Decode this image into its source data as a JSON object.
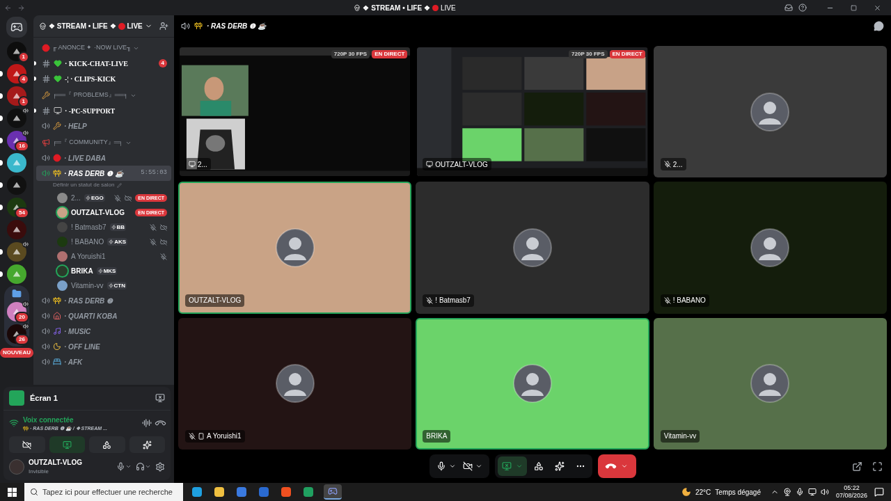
{
  "window": {
    "title": "❖ STREAM • LIFE ❖",
    "title_live": "LIVE"
  },
  "servers": [
    {
      "kind": "server",
      "color": "#0d0d0d",
      "badge": "1",
      "unread": false,
      "voice": false
    },
    {
      "kind": "server",
      "color": "#c01818",
      "badge": "4",
      "unread": true,
      "voice": false
    },
    {
      "kind": "server",
      "color": "#a51a1a",
      "badge": "1",
      "unread": true,
      "voice": false
    },
    {
      "kind": "server",
      "color": "#101010",
      "unread": true,
      "voice": true
    },
    {
      "kind": "server",
      "color": "#6a30b0",
      "badge": "16",
      "unread": true,
      "voice": true
    },
    {
      "kind": "server",
      "color": "#3ab8cc",
      "unread": true,
      "voice": false
    },
    {
      "kind": "server",
      "color": "#111111",
      "unread": true,
      "voice": false
    },
    {
      "kind": "server",
      "color": "#1c3a10",
      "badge": "54",
      "unread": true,
      "voice": false
    },
    {
      "kind": "server",
      "color": "#3a0c0c",
      "unread": false,
      "voice": false
    },
    {
      "kind": "server",
      "color": "#5a4a20",
      "unread": true,
      "voice": true
    },
    {
      "kind": "server",
      "color": "#46a82e",
      "unread": true,
      "voice": false
    },
    {
      "kind": "folder",
      "children": [
        {
          "color": "#d080c0",
          "badge": "20",
          "voice": true
        },
        {
          "color": "#1a0808",
          "badge": "26",
          "voice": true
        }
      ]
    }
  ],
  "new_badge": "NOUVEAU",
  "server_name": "❖ STREAM • LIFE ❖",
  "server_live": "LIVE",
  "channels": [
    {
      "kind": "category",
      "name": "╓ ANONCE ✦ ·NOW LIVE╖"
    },
    {
      "kind": "text",
      "name": "· KICK-CHAT-LIVE",
      "unread": true,
      "badge": "4"
    },
    {
      "kind": "text",
      "name": "-¦ · CLIPS-KICK",
      "unread": true
    },
    {
      "kind": "category",
      "name": "╒══『 PROBLEMS』══╕"
    },
    {
      "kind": "text",
      "name": "· -PC-SUPPORT",
      "unread": true
    },
    {
      "kind": "voice",
      "name": "· HELP",
      "selected": false
    },
    {
      "kind": "category",
      "name": "╒═『 COMMUNITY』═╕"
    },
    {
      "kind": "voice",
      "name": "· LIVE DABA",
      "selected": false
    },
    {
      "kind": "voice",
      "name": "· RAS DERB ❶ ☕",
      "selected": true,
      "timer": "5:55:03",
      "status": "Définir un statut de salon",
      "members": [
        {
          "name": "2...",
          "tag": "EGO",
          "live_badge": "EN DIRECT",
          "muted": true,
          "camera_off": true,
          "speaking": false,
          "color": "#8a8a8a"
        },
        {
          "name": "OUTZALT-VLOG",
          "live_badge": "EN DIRECT",
          "muted": false,
          "camera_off": false,
          "speaking": true,
          "color": "#c8a287"
        },
        {
          "name": "! Batmasb7",
          "tag": "BB",
          "muted": true,
          "camera_off": true,
          "speaking": false,
          "color": "#444444"
        },
        {
          "name": "! BABANO",
          "tag": "AKS",
          "muted": true,
          "camera_off": true,
          "speaking": false,
          "color": "#1c3a10"
        },
        {
          "name": "A Yoruishi1",
          "muted": true,
          "camera_off": false,
          "speaking": false,
          "color": "#b07070"
        },
        {
          "name": "BRIKA",
          "tag": "MKS",
          "muted": false,
          "camera_off": false,
          "speaking": true,
          "color": "#2a3a2a"
        },
        {
          "name": "Vitamin-vv",
          "tag": "CTN",
          "muted": false,
          "camera_off": false,
          "speaking": false,
          "color": "#7aa0c8"
        }
      ]
    },
    {
      "kind": "voice",
      "name": "· RAS DERB ❷",
      "selected": false
    },
    {
      "kind": "voice",
      "name": "· QUARTI KOBA",
      "selected": false
    },
    {
      "kind": "voice",
      "name": "· MUSIC",
      "selected": false
    },
    {
      "kind": "voice",
      "name": "· OFF LINE",
      "selected": false
    },
    {
      "kind": "voice",
      "name": "· AFK",
      "selected": false
    }
  ],
  "stream_panel": {
    "title": "Écran 1"
  },
  "voice_panel": {
    "status": "Voix connectée",
    "location": "· RAS DERB ❶ ☕ / ❖ STREAM ..."
  },
  "controls": {
    "mic_muted": false,
    "camera_on": false,
    "screen_share": true
  },
  "user": {
    "name": "OUTZALT-VLOG",
    "status": "Invisible"
  },
  "header": {
    "channel": "· RAS DERB ❶ ☕"
  },
  "tiles": [
    {
      "kind": "stream",
      "label": "2...",
      "quality": "720P 30 FPS",
      "live": "EN DIRECT",
      "speaking": false
    },
    {
      "kind": "stream",
      "label": "OUTZALT-VLOG",
      "quality": "720P 30 FPS",
      "live": "EN DIRECT",
      "speaking": false
    },
    {
      "kind": "avatar",
      "label": "2...",
      "color": "#3a3a3a",
      "muted": true,
      "mobile": false,
      "speaking": false
    },
    {
      "kind": "avatar",
      "label": "OUTZALT-VLOG",
      "color": "#c9a386",
      "muted": false,
      "mobile": false,
      "speaking": true
    },
    {
      "kind": "avatar",
      "label": "! Batmasb7",
      "color": "#2c2c2c",
      "muted": true,
      "mobile": false,
      "speaking": false
    },
    {
      "kind": "avatar",
      "label": "! BABANO",
      "color": "#141d0c",
      "muted": true,
      "mobile": false,
      "speaking": false
    },
    {
      "kind": "avatar",
      "label": "A Yoruishi1",
      "color": "#231414",
      "muted": true,
      "mobile": true,
      "speaking": false
    },
    {
      "kind": "avatar",
      "label": "BRIKA",
      "color": "#6bd36a",
      "muted": false,
      "mobile": false,
      "speaking": true
    },
    {
      "kind": "avatar",
      "label": "Vitamin-vv",
      "color": "#56704a",
      "muted": false,
      "mobile": false,
      "speaking": false
    }
  ],
  "taskbar": {
    "search_placeholder": "Tapez ici pour effectuer une recherche",
    "temperature": "22°C",
    "weather": "Temps dégagé",
    "time": "05:22",
    "date": "07/08/2026"
  }
}
